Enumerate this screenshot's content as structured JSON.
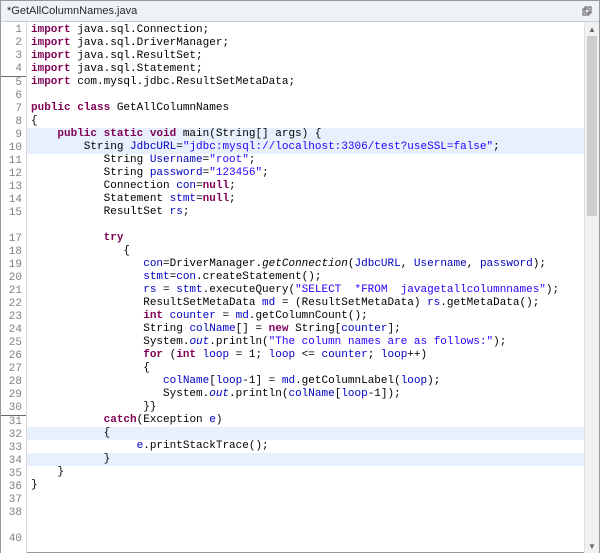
{
  "titlebar": {
    "filename": "*GetAllColumnNames.java"
  },
  "gutter": {
    "lines": [
      1,
      2,
      3,
      4,
      5,
      6,
      7,
      8,
      9,
      10,
      11,
      12,
      13,
      14,
      15,
      "",
      17,
      18,
      19,
      20,
      21,
      22,
      23,
      24,
      25,
      26,
      27,
      28,
      29,
      30,
      31,
      32,
      33,
      34,
      35,
      36,
      37,
      38,
      "",
      40
    ],
    "marked": {
      "3": true,
      "29": true
    }
  },
  "code": {
    "lines": [
      {
        "tokens": [
          {
            "t": "import ",
            "c": "kw"
          },
          {
            "t": "java.sql.Connection;",
            "c": "id"
          }
        ]
      },
      {
        "tokens": [
          {
            "t": "import ",
            "c": "kw"
          },
          {
            "t": "java.sql.DriverManager;",
            "c": "id"
          }
        ]
      },
      {
        "tokens": [
          {
            "t": "import ",
            "c": "kw"
          },
          {
            "t": "java.sql.ResultSet;",
            "c": "id"
          }
        ]
      },
      {
        "tokens": [
          {
            "t": "import ",
            "c": "kw"
          },
          {
            "t": "java.sql.Statement;",
            "c": "id"
          }
        ]
      },
      {
        "tokens": [
          {
            "t": "import ",
            "c": "kw"
          },
          {
            "t": "com.mysql.jdbc.ResultSetMetaData;",
            "c": "id"
          }
        ]
      },
      {
        "tokens": []
      },
      {
        "tokens": [
          {
            "t": "public class ",
            "c": "kw"
          },
          {
            "t": "GetAllColumnNames",
            "c": "id"
          }
        ]
      },
      {
        "tokens": [
          {
            "t": "{",
            "c": "pun"
          }
        ]
      },
      {
        "hl": true,
        "tokens": [
          {
            "t": "    ",
            "c": "id"
          },
          {
            "t": "public static void ",
            "c": "kw"
          },
          {
            "t": "main(String[] args) {",
            "c": "id"
          }
        ]
      },
      {
        "hl": true,
        "tokens": [
          {
            "t": "        String ",
            "c": "id"
          },
          {
            "t": "JdbcURL",
            "c": "fld"
          },
          {
            "t": "=",
            "c": "pun"
          },
          {
            "t": "\"jdbc:mysql://localhost:3306/test?useSSL=false\"",
            "c": "str"
          },
          {
            "t": ";",
            "c": "pun"
          }
        ]
      },
      {
        "tokens": [
          {
            "t": "           String ",
            "c": "id"
          },
          {
            "t": "Username",
            "c": "fld"
          },
          {
            "t": "=",
            "c": "pun"
          },
          {
            "t": "\"root\"",
            "c": "str"
          },
          {
            "t": ";",
            "c": "pun"
          }
        ]
      },
      {
        "tokens": [
          {
            "t": "           String ",
            "c": "id"
          },
          {
            "t": "password",
            "c": "fld"
          },
          {
            "t": "=",
            "c": "pun"
          },
          {
            "t": "\"123456\"",
            "c": "str"
          },
          {
            "t": ";",
            "c": "pun"
          }
        ]
      },
      {
        "tokens": [
          {
            "t": "           Connection ",
            "c": "id"
          },
          {
            "t": "con",
            "c": "fld"
          },
          {
            "t": "=",
            "c": "pun"
          },
          {
            "t": "null",
            "c": "kw"
          },
          {
            "t": ";",
            "c": "pun"
          }
        ]
      },
      {
        "tokens": [
          {
            "t": "           Statement ",
            "c": "id"
          },
          {
            "t": "stmt",
            "c": "fld"
          },
          {
            "t": "=",
            "c": "pun"
          },
          {
            "t": "null",
            "c": "kw"
          },
          {
            "t": ";",
            "c": "pun"
          }
        ]
      },
      {
        "tokens": [
          {
            "t": "           ResultSet ",
            "c": "id"
          },
          {
            "t": "rs",
            "c": "fld"
          },
          {
            "t": ";",
            "c": "pun"
          }
        ]
      },
      {
        "tokens": []
      },
      {
        "tokens": [
          {
            "t": "           ",
            "c": "id"
          },
          {
            "t": "try",
            "c": "kw"
          }
        ]
      },
      {
        "tokens": [
          {
            "t": "              {",
            "c": "pun"
          }
        ]
      },
      {
        "tokens": [
          {
            "t": "                 ",
            "c": "id"
          },
          {
            "t": "con",
            "c": "fld"
          },
          {
            "t": "=DriverManager.",
            "c": "id"
          },
          {
            "t": "getConnection",
            "c": "meth"
          },
          {
            "t": "(",
            "c": "pun"
          },
          {
            "t": "JdbcURL",
            "c": "fld"
          },
          {
            "t": ", ",
            "c": "pun"
          },
          {
            "t": "Username",
            "c": "fld"
          },
          {
            "t": ", ",
            "c": "pun"
          },
          {
            "t": "password",
            "c": "fld"
          },
          {
            "t": ");",
            "c": "pun"
          }
        ]
      },
      {
        "tokens": [
          {
            "t": "                 ",
            "c": "id"
          },
          {
            "t": "stmt",
            "c": "fld"
          },
          {
            "t": "=",
            "c": "pun"
          },
          {
            "t": "con",
            "c": "fld"
          },
          {
            "t": ".createStatement();",
            "c": "id"
          }
        ]
      },
      {
        "tokens": [
          {
            "t": "                 ",
            "c": "id"
          },
          {
            "t": "rs",
            "c": "fld"
          },
          {
            "t": " = ",
            "c": "pun"
          },
          {
            "t": "stmt",
            "c": "fld"
          },
          {
            "t": ".executeQuery(",
            "c": "id"
          },
          {
            "t": "\"SELECT  *FROM  javagetallcolumnnames\"",
            "c": "str"
          },
          {
            "t": ");",
            "c": "pun"
          }
        ]
      },
      {
        "tokens": [
          {
            "t": "                 ResultSetMetaData ",
            "c": "id"
          },
          {
            "t": "md",
            "c": "fld"
          },
          {
            "t": " = (ResultSetMetaData) ",
            "c": "id"
          },
          {
            "t": "rs",
            "c": "fld"
          },
          {
            "t": ".getMetaData();",
            "c": "id"
          }
        ]
      },
      {
        "tokens": [
          {
            "t": "                 ",
            "c": "id"
          },
          {
            "t": "int ",
            "c": "kw"
          },
          {
            "t": "counter",
            "c": "fld"
          },
          {
            "t": " = ",
            "c": "pun"
          },
          {
            "t": "md",
            "c": "fld"
          },
          {
            "t": ".getColumnCount();",
            "c": "id"
          }
        ]
      },
      {
        "tokens": [
          {
            "t": "                 String ",
            "c": "id"
          },
          {
            "t": "colName",
            "c": "fld"
          },
          {
            "t": "[] = ",
            "c": "pun"
          },
          {
            "t": "new ",
            "c": "kw"
          },
          {
            "t": "String[",
            "c": "id"
          },
          {
            "t": "counter",
            "c": "fld"
          },
          {
            "t": "];",
            "c": "pun"
          }
        ]
      },
      {
        "tokens": [
          {
            "t": "                 System.",
            "c": "id"
          },
          {
            "t": "out",
            "c": "stat"
          },
          {
            "t": ".println(",
            "c": "id"
          },
          {
            "t": "\"The column names are as follows:\"",
            "c": "str"
          },
          {
            "t": ");",
            "c": "pun"
          }
        ]
      },
      {
        "tokens": [
          {
            "t": "                 ",
            "c": "id"
          },
          {
            "t": "for ",
            "c": "kw"
          },
          {
            "t": "(",
            "c": "pun"
          },
          {
            "t": "int ",
            "c": "kw"
          },
          {
            "t": "loop",
            "c": "fld"
          },
          {
            "t": " = 1; ",
            "c": "pun"
          },
          {
            "t": "loop",
            "c": "fld"
          },
          {
            "t": " <= ",
            "c": "pun"
          },
          {
            "t": "counter",
            "c": "fld"
          },
          {
            "t": "; ",
            "c": "pun"
          },
          {
            "t": "loop",
            "c": "fld"
          },
          {
            "t": "++)",
            "c": "pun"
          }
        ]
      },
      {
        "tokens": [
          {
            "t": "                 {",
            "c": "pun"
          }
        ]
      },
      {
        "tokens": [
          {
            "t": "                    ",
            "c": "id"
          },
          {
            "t": "colName",
            "c": "fld"
          },
          {
            "t": "[",
            "c": "pun"
          },
          {
            "t": "loop",
            "c": "fld"
          },
          {
            "t": "-1] = ",
            "c": "pun"
          },
          {
            "t": "md",
            "c": "fld"
          },
          {
            "t": ".getColumnLabel(",
            "c": "id"
          },
          {
            "t": "loop",
            "c": "fld"
          },
          {
            "t": ");",
            "c": "pun"
          }
        ]
      },
      {
        "tokens": [
          {
            "t": "                    System.",
            "c": "id"
          },
          {
            "t": "out",
            "c": "stat"
          },
          {
            "t": ".println(",
            "c": "id"
          },
          {
            "t": "colName",
            "c": "fld"
          },
          {
            "t": "[",
            "c": "pun"
          },
          {
            "t": "loop",
            "c": "fld"
          },
          {
            "t": "-1]);",
            "c": "pun"
          }
        ]
      },
      {
        "tokens": [
          {
            "t": "                 }}",
            "c": "pun"
          }
        ]
      },
      {
        "tokens": [
          {
            "t": "           ",
            "c": "id"
          },
          {
            "t": "catch",
            "c": "kw"
          },
          {
            "t": "(Exception ",
            "c": "id"
          },
          {
            "t": "e",
            "c": "fld"
          },
          {
            "t": ")",
            "c": "pun"
          }
        ]
      },
      {
        "hl": true,
        "tokens": [
          {
            "t": "           {",
            "c": "pun"
          }
        ]
      },
      {
        "tokens": [
          {
            "t": "                ",
            "c": "id"
          },
          {
            "t": "e",
            "c": "fld"
          },
          {
            "t": ".printStackTrace();",
            "c": "id"
          }
        ]
      },
      {
        "hl": true,
        "tokens": [
          {
            "t": "           }",
            "c": "pun"
          }
        ]
      },
      {
        "tokens": [
          {
            "t": "    }",
            "c": "pun"
          }
        ]
      },
      {
        "tokens": [
          {
            "t": "}",
            "c": "pun"
          }
        ]
      },
      {
        "tokens": []
      },
      {
        "tokens": []
      },
      {
        "tokens": []
      },
      {
        "tokens": []
      }
    ]
  }
}
